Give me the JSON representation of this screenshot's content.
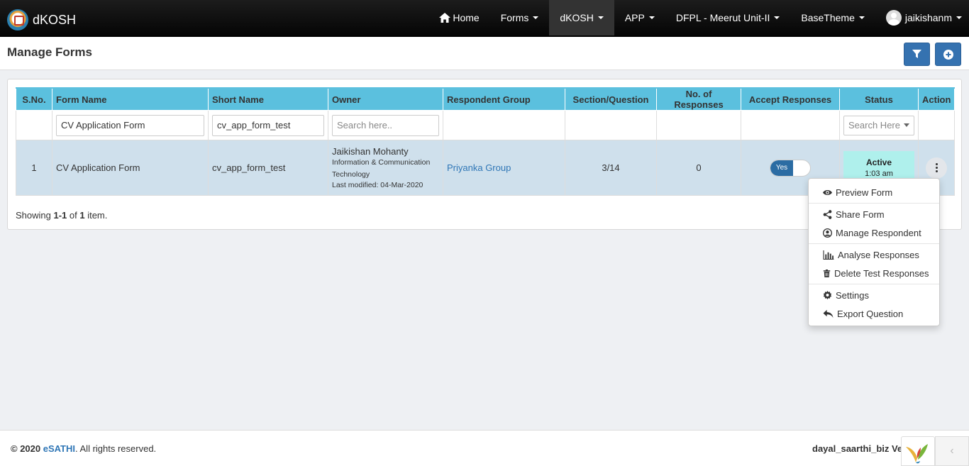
{
  "brand": {
    "name": "dKOSH"
  },
  "nav": {
    "home": "Home",
    "forms": "Forms",
    "dkosh": "dKOSH",
    "app": "APP",
    "unit": "DFPL - Meerut Unit-II",
    "theme": "BaseTheme",
    "user": "jaikishanm"
  },
  "page": {
    "title": "Manage Forms"
  },
  "table": {
    "headers": {
      "sno": "S.No.",
      "form_name": "Form Name",
      "short_name": "Short Name",
      "owner": "Owner",
      "respondent_group": "Respondent Group",
      "section_question": "Section/Question",
      "responses": "No. of Responses",
      "accept": "Accept Responses",
      "status": "Status",
      "action": "Action"
    },
    "filters": {
      "form_name_value": "CV Application Form",
      "short_name_value": "cv_app_form_test",
      "owner_placeholder": "Search here..",
      "status_placeholder": "Search Here"
    },
    "rows": [
      {
        "sno": "1",
        "form_name": "CV Application Form",
        "short_name": "cv_app_form_test",
        "owner_name": "Jaikishan Mohanty",
        "owner_dept": "Information & Communication Technology",
        "owner_modified": "Last modified: 04-Mar-2020",
        "respondent_group": "Priyanka Group",
        "section_question": "3/14",
        "responses": "0",
        "accept": "Yes",
        "status": "Active",
        "status_time": "1:03 am"
      }
    ],
    "summary": {
      "prefix": "Showing ",
      "range": "1-1",
      "mid": " of ",
      "total": "1",
      "suffix": " item."
    }
  },
  "action_menu": {
    "preview": "Preview Form",
    "share": "Share Form",
    "manage_respondent": "Manage Respondent",
    "analyse": "Analyse Responses",
    "delete_test": "Delete Test Responses",
    "settings": "Settings",
    "export": "Export Question"
  },
  "footer": {
    "copyright_prefix": "© 2020 ",
    "company": "eSATHI",
    "copyright_suffix": ". All rights reserved.",
    "version_text": "dayal_saarthi_biz Ve"
  },
  "colors": {
    "header_bg": "#5bc0de",
    "row_bg": "#cfe0ec",
    "primary": "#3572b0",
    "status_bg": "#aff0ec",
    "link": "#2f76b6"
  }
}
